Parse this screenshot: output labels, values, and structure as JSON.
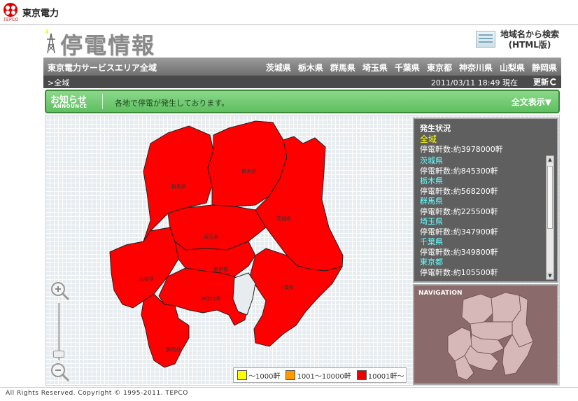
{
  "header": {
    "brand": "東京電力",
    "brand_small": "TEPCO",
    "page_title": "停電情報",
    "search_link": "地域名から検索\n(HTML版)"
  },
  "region_bar": {
    "service_area": "東京電力サービスエリア全域",
    "prefectures": [
      "茨城県",
      "栃木県",
      "群馬県",
      "埼玉県",
      "千葉県",
      "東京都",
      "神奈川県",
      "山梨県",
      "静岡県"
    ]
  },
  "crumb_bar": {
    "breadcrumb": ">全域",
    "timestamp": "2011/03/11 18:49 現在",
    "refresh_label": "更新"
  },
  "announce": {
    "title": "お知らせ",
    "subtitle": "ANNOUNCE",
    "message": "各地で停電が発生しております。",
    "fulltext_button": "全文表示▼"
  },
  "map": {
    "labels": {
      "gunma": "群馬県",
      "tochigi": "栃木県",
      "ibaraki": "茨城県",
      "saitama": "埼玉県",
      "tokyo": "東京都",
      "yamanashi": "山梨県",
      "kanagawa": "神奈川県",
      "chiba": "千葉県",
      "shizuoka": "静岡県"
    },
    "fill_color": "#ff0000"
  },
  "status_panel": {
    "title": "発生状況",
    "items": [
      {
        "name": "全域",
        "count": "停電軒数:約3978000軒"
      },
      {
        "name": "茨城県",
        "count": "停電軒数:約845300軒"
      },
      {
        "name": "栃木県",
        "count": "停電軒数:約568200軒"
      },
      {
        "name": "群馬県",
        "count": "停電軒数:約225500軒"
      },
      {
        "name": "埼玉県",
        "count": "停電軒数:約347900軒"
      },
      {
        "name": "千葉県",
        "count": "停電軒数:約349800軒"
      },
      {
        "name": "東京都",
        "count": "停電軒数:約105500軒"
      }
    ]
  },
  "navigation": {
    "title": "NAVIGATION"
  },
  "legend": {
    "items": [
      {
        "label": "～1000軒",
        "color": "#ffff00"
      },
      {
        "label": "1001～10000軒",
        "color": "#ff9900"
      },
      {
        "label": "10001軒～",
        "color": "#ee0000"
      }
    ]
  },
  "footer": {
    "copyright": "All Rights Reserved. Copyright © 1995-2011. TEPCO"
  }
}
